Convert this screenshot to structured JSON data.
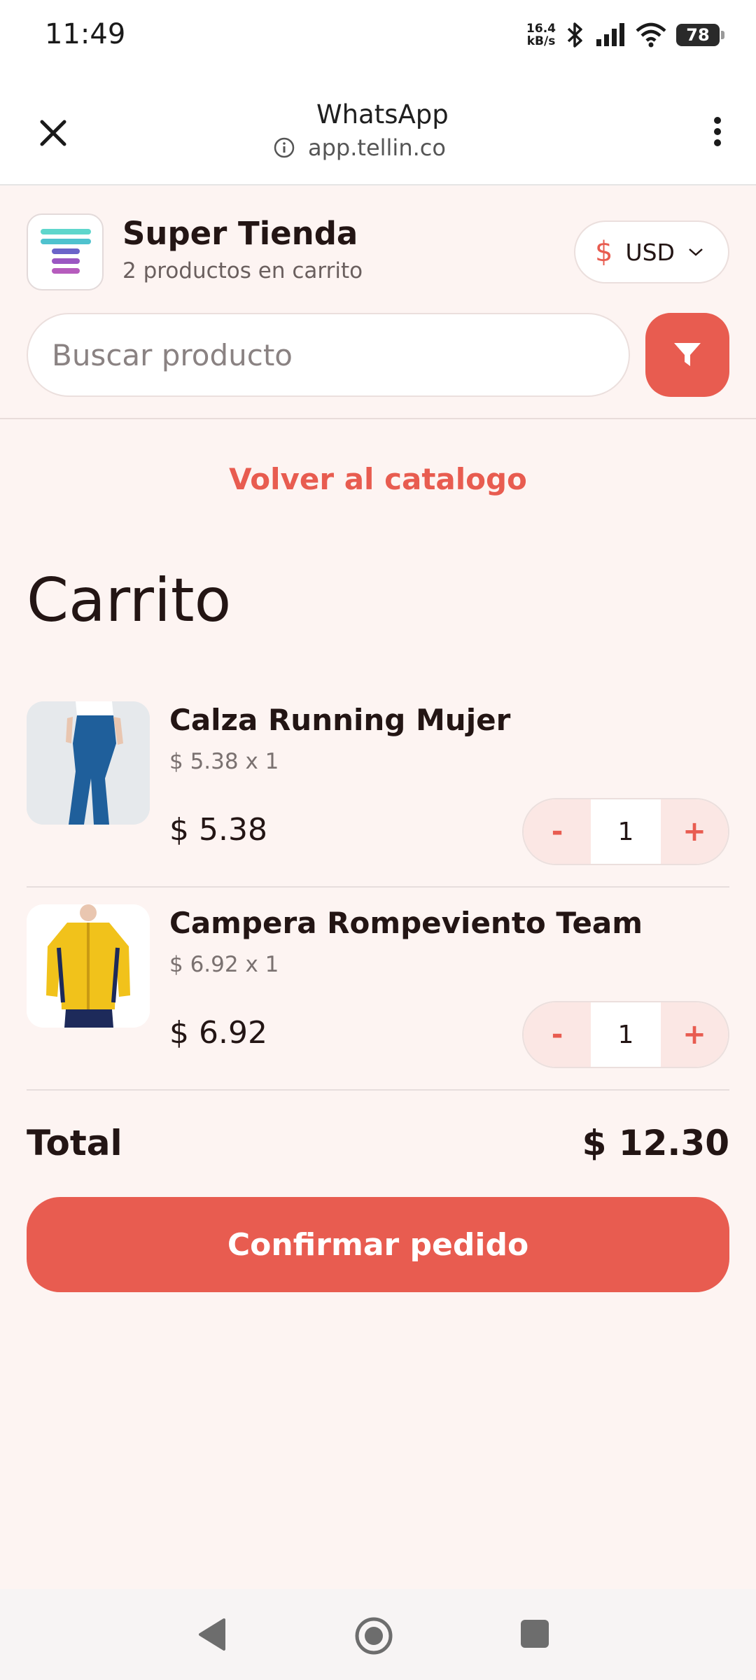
{
  "status_bar": {
    "time": "11:49",
    "net_speed_value": "16.4",
    "net_speed_unit": "kB/s",
    "battery": "78"
  },
  "browser": {
    "title": "WhatsApp",
    "url": "app.tellin.co"
  },
  "store": {
    "name": "Super Tienda",
    "cart_count_text": "2 productos en carrito",
    "currency_symbol": "$",
    "currency_code": "USD",
    "search_placeholder": "Buscar producto"
  },
  "main": {
    "back_link": "Volver al catalogo",
    "title": "Carrito",
    "items": [
      {
        "name": "Calza Running Mujer",
        "unit_line": "$ 5.38 x 1",
        "price": "$ 5.38",
        "quantity": "1",
        "minus": "-",
        "plus": "+"
      },
      {
        "name": "Campera Rompeviento Team",
        "unit_line": "$ 6.92 x 1",
        "price": "$ 6.92",
        "quantity": "1",
        "minus": "-",
        "plus": "+"
      }
    ],
    "total_label": "Total",
    "total_value": "$ 12.30",
    "confirm_label": "Confirmar pedido"
  },
  "colors": {
    "accent": "#e85c50",
    "background": "#fdf4f2",
    "text": "#231514"
  }
}
